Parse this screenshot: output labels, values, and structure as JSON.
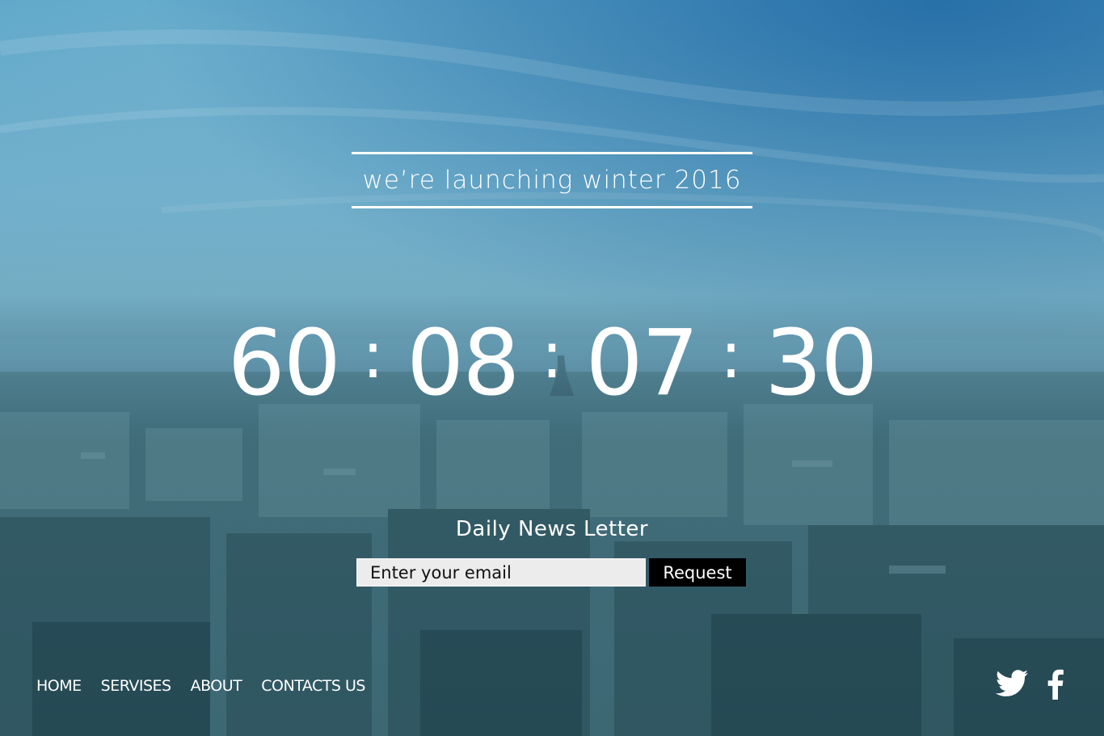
{
  "headline": "we’re launching winter 2016",
  "countdown": {
    "days": "60",
    "hours": "08",
    "minutes": "07",
    "seconds": "30",
    "separator": ":"
  },
  "newsletter": {
    "title": "Daily News Letter",
    "email_placeholder": "Enter your email",
    "button_label": "Request"
  },
  "nav": {
    "items": [
      {
        "label": "HOME"
      },
      {
        "label": "SERVISES"
      },
      {
        "label": "ABOUT"
      },
      {
        "label": "CONTACTS US"
      }
    ]
  },
  "social": {
    "icons": [
      "twitter-icon",
      "facebook-icon"
    ]
  },
  "colors": {
    "text": "#ffffff",
    "button_bg": "#000000",
    "input_bg": "#ececec"
  }
}
